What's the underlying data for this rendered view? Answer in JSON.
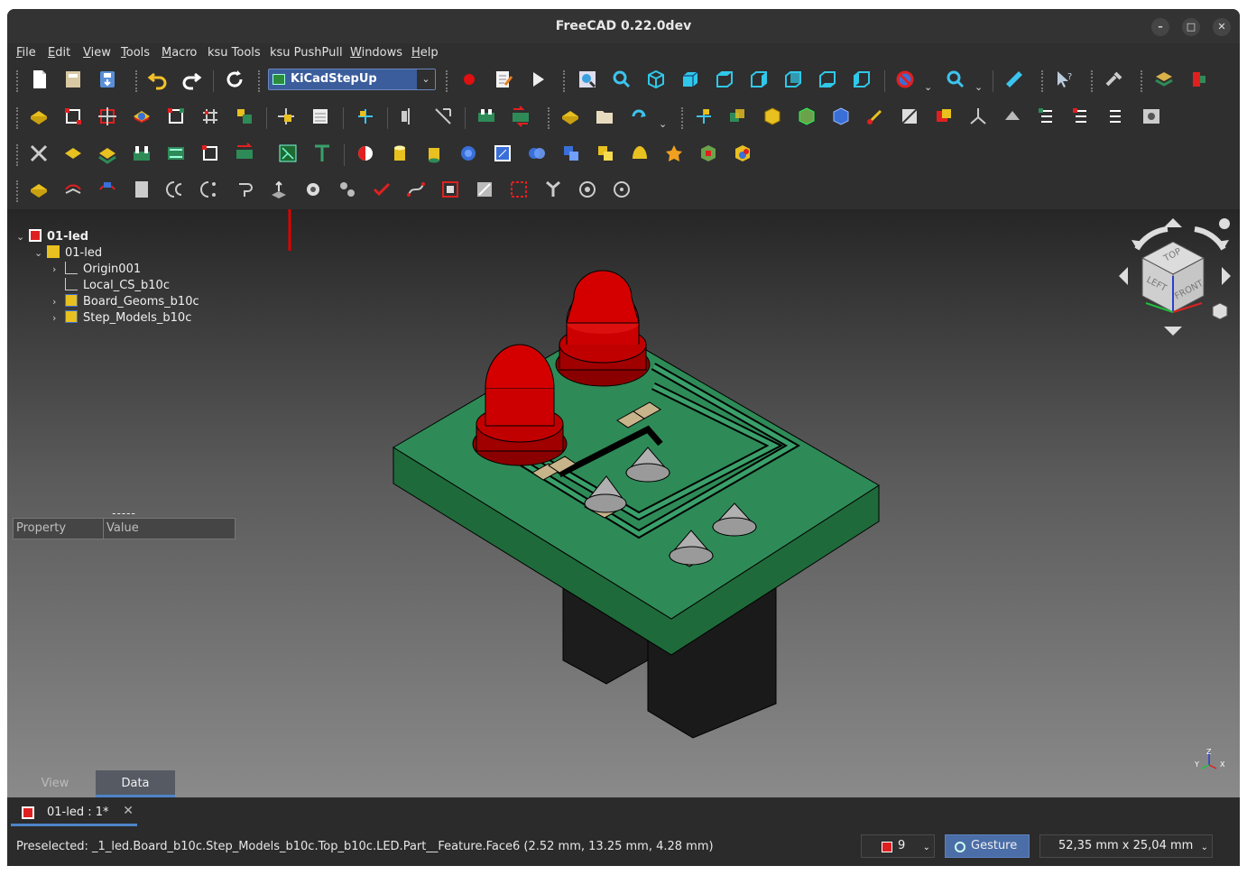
{
  "window": {
    "title": "FreeCAD 0.22.0dev",
    "controls": [
      "–",
      "□",
      "✕"
    ]
  },
  "menu": [
    {
      "key": "F",
      "rest": "ile"
    },
    {
      "key": "E",
      "rest": "dit"
    },
    {
      "key": "V",
      "rest": "iew"
    },
    {
      "key": "T",
      "rest": "ools"
    },
    {
      "key": "M",
      "rest": "acro"
    },
    {
      "key": "",
      "rest": "ksu Tools"
    },
    {
      "key": "",
      "rest": "ksu PushPull"
    },
    {
      "key": "W",
      "rest": "indows"
    },
    {
      "key": "H",
      "rest": "elp"
    }
  ],
  "workbench": {
    "selected": "KiCadStepUp"
  },
  "tree": {
    "root": "01-led",
    "items": [
      {
        "label": "01-led"
      },
      {
        "label": "Origin001"
      },
      {
        "label": "Local_CS_b10c"
      },
      {
        "label": "Board_Geoms_b10c"
      },
      {
        "label": "Step_Models_b10c"
      }
    ]
  },
  "property_panel": {
    "dashes": "-----",
    "col_property": "Property",
    "col_value": "Value"
  },
  "combo_tabs": {
    "view": "View",
    "data": "Data"
  },
  "navcube": {
    "top": "TOP",
    "front": "FRONT",
    "left": "LEFT"
  },
  "axis_labels": {
    "z": "Z",
    "y": "Y",
    "x": "X"
  },
  "document_tab": {
    "label": "01-led : 1*",
    "close": "✕"
  },
  "status": {
    "preselected": "Preselected: _1_led.Board_b10c.Step_Models_b10c.Top_b10c.LED.Part__Feature.Face6 (2.52 mm, 13.25 mm, 4.28 mm)",
    "counter": "9",
    "navigation_style": "Gesture",
    "dimensions": "52,35 mm x 25,04 mm"
  },
  "colors": {
    "pcb_green": "#2e8b57",
    "led_red": "#cc0000",
    "highlight_annotation": "#e00000",
    "accent_blue": "#4e84c9"
  }
}
